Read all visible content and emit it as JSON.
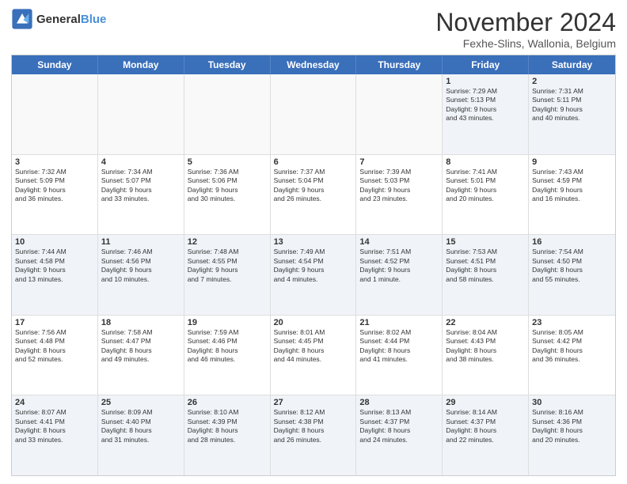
{
  "logo": {
    "line1": "General",
    "line2": "Blue"
  },
  "title": "November 2024",
  "location": "Fexhe-Slins, Wallonia, Belgium",
  "header_days": [
    "Sunday",
    "Monday",
    "Tuesday",
    "Wednesday",
    "Thursday",
    "Friday",
    "Saturday"
  ],
  "rows": [
    [
      {
        "day": "",
        "info": ""
      },
      {
        "day": "",
        "info": ""
      },
      {
        "day": "",
        "info": ""
      },
      {
        "day": "",
        "info": ""
      },
      {
        "day": "",
        "info": ""
      },
      {
        "day": "1",
        "info": "Sunrise: 7:29 AM\nSunset: 5:13 PM\nDaylight: 9 hours\nand 43 minutes."
      },
      {
        "day": "2",
        "info": "Sunrise: 7:31 AM\nSunset: 5:11 PM\nDaylight: 9 hours\nand 40 minutes."
      }
    ],
    [
      {
        "day": "3",
        "info": "Sunrise: 7:32 AM\nSunset: 5:09 PM\nDaylight: 9 hours\nand 36 minutes."
      },
      {
        "day": "4",
        "info": "Sunrise: 7:34 AM\nSunset: 5:07 PM\nDaylight: 9 hours\nand 33 minutes."
      },
      {
        "day": "5",
        "info": "Sunrise: 7:36 AM\nSunset: 5:06 PM\nDaylight: 9 hours\nand 30 minutes."
      },
      {
        "day": "6",
        "info": "Sunrise: 7:37 AM\nSunset: 5:04 PM\nDaylight: 9 hours\nand 26 minutes."
      },
      {
        "day": "7",
        "info": "Sunrise: 7:39 AM\nSunset: 5:03 PM\nDaylight: 9 hours\nand 23 minutes."
      },
      {
        "day": "8",
        "info": "Sunrise: 7:41 AM\nSunset: 5:01 PM\nDaylight: 9 hours\nand 20 minutes."
      },
      {
        "day": "9",
        "info": "Sunrise: 7:43 AM\nSunset: 4:59 PM\nDaylight: 9 hours\nand 16 minutes."
      }
    ],
    [
      {
        "day": "10",
        "info": "Sunrise: 7:44 AM\nSunset: 4:58 PM\nDaylight: 9 hours\nand 13 minutes."
      },
      {
        "day": "11",
        "info": "Sunrise: 7:46 AM\nSunset: 4:56 PM\nDaylight: 9 hours\nand 10 minutes."
      },
      {
        "day": "12",
        "info": "Sunrise: 7:48 AM\nSunset: 4:55 PM\nDaylight: 9 hours\nand 7 minutes."
      },
      {
        "day": "13",
        "info": "Sunrise: 7:49 AM\nSunset: 4:54 PM\nDaylight: 9 hours\nand 4 minutes."
      },
      {
        "day": "14",
        "info": "Sunrise: 7:51 AM\nSunset: 4:52 PM\nDaylight: 9 hours\nand 1 minute."
      },
      {
        "day": "15",
        "info": "Sunrise: 7:53 AM\nSunset: 4:51 PM\nDaylight: 8 hours\nand 58 minutes."
      },
      {
        "day": "16",
        "info": "Sunrise: 7:54 AM\nSunset: 4:50 PM\nDaylight: 8 hours\nand 55 minutes."
      }
    ],
    [
      {
        "day": "17",
        "info": "Sunrise: 7:56 AM\nSunset: 4:48 PM\nDaylight: 8 hours\nand 52 minutes."
      },
      {
        "day": "18",
        "info": "Sunrise: 7:58 AM\nSunset: 4:47 PM\nDaylight: 8 hours\nand 49 minutes."
      },
      {
        "day": "19",
        "info": "Sunrise: 7:59 AM\nSunset: 4:46 PM\nDaylight: 8 hours\nand 46 minutes."
      },
      {
        "day": "20",
        "info": "Sunrise: 8:01 AM\nSunset: 4:45 PM\nDaylight: 8 hours\nand 44 minutes."
      },
      {
        "day": "21",
        "info": "Sunrise: 8:02 AM\nSunset: 4:44 PM\nDaylight: 8 hours\nand 41 minutes."
      },
      {
        "day": "22",
        "info": "Sunrise: 8:04 AM\nSunset: 4:43 PM\nDaylight: 8 hours\nand 38 minutes."
      },
      {
        "day": "23",
        "info": "Sunrise: 8:05 AM\nSunset: 4:42 PM\nDaylight: 8 hours\nand 36 minutes."
      }
    ],
    [
      {
        "day": "24",
        "info": "Sunrise: 8:07 AM\nSunset: 4:41 PM\nDaylight: 8 hours\nand 33 minutes."
      },
      {
        "day": "25",
        "info": "Sunrise: 8:09 AM\nSunset: 4:40 PM\nDaylight: 8 hours\nand 31 minutes."
      },
      {
        "day": "26",
        "info": "Sunrise: 8:10 AM\nSunset: 4:39 PM\nDaylight: 8 hours\nand 28 minutes."
      },
      {
        "day": "27",
        "info": "Sunrise: 8:12 AM\nSunset: 4:38 PM\nDaylight: 8 hours\nand 26 minutes."
      },
      {
        "day": "28",
        "info": "Sunrise: 8:13 AM\nSunset: 4:37 PM\nDaylight: 8 hours\nand 24 minutes."
      },
      {
        "day": "29",
        "info": "Sunrise: 8:14 AM\nSunset: 4:37 PM\nDaylight: 8 hours\nand 22 minutes."
      },
      {
        "day": "30",
        "info": "Sunrise: 8:16 AM\nSunset: 4:36 PM\nDaylight: 8 hours\nand 20 minutes."
      }
    ]
  ]
}
